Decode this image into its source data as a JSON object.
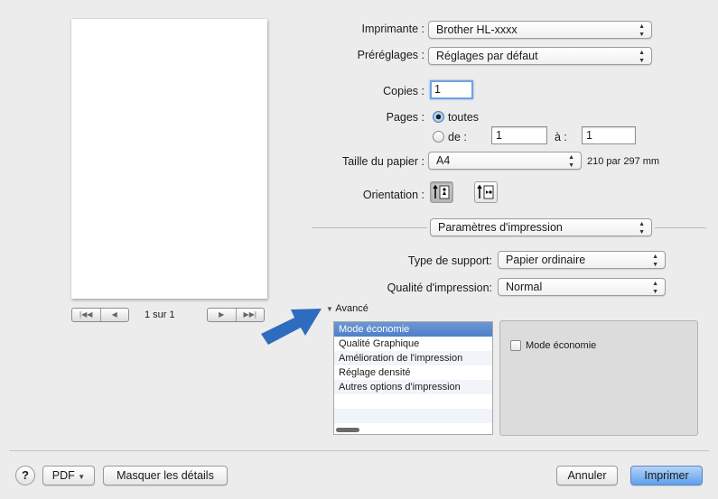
{
  "printer": {
    "label": "Imprimante :",
    "value": "Brother HL-xxxx"
  },
  "presets": {
    "label": "Préréglages :",
    "value": "Réglages par défaut"
  },
  "copies": {
    "label": "Copies :",
    "value": "1"
  },
  "pages": {
    "label": "Pages :",
    "all_label": "toutes",
    "range_from_label": "de :",
    "from_value": "1",
    "range_to_label": "à :",
    "to_value": "1"
  },
  "paper": {
    "label": "Taille du papier :",
    "value": "A4",
    "dimensions": "210 par 297 mm"
  },
  "orientation": {
    "label": "Orientation :"
  },
  "section_popup": {
    "value": "Paramètres d'impression"
  },
  "media_type": {
    "label": "Type de support:",
    "value": "Papier ordinaire"
  },
  "print_quality": {
    "label": "Qualité d'impression:",
    "value": "Normal"
  },
  "advanced": {
    "label": "Avancé",
    "items": [
      "Mode économie",
      "Qualité Graphique",
      "Amélioration de l'impression",
      "Réglage densité",
      "Autres options d'impression"
    ],
    "selected_index": 0,
    "checkbox_label": "Mode économie",
    "checkbox_checked": false
  },
  "preview_nav": {
    "page_info": "1 sur 1"
  },
  "bottom": {
    "help": "?",
    "pdf_label": "PDF",
    "details_label": "Masquer les détails",
    "cancel_label": "Annuler",
    "print_label": "Imprimer"
  },
  "colors": {
    "accent": "#2e6cc0",
    "default_button": "#5ea0ec",
    "selection": "#4f7fc8"
  }
}
